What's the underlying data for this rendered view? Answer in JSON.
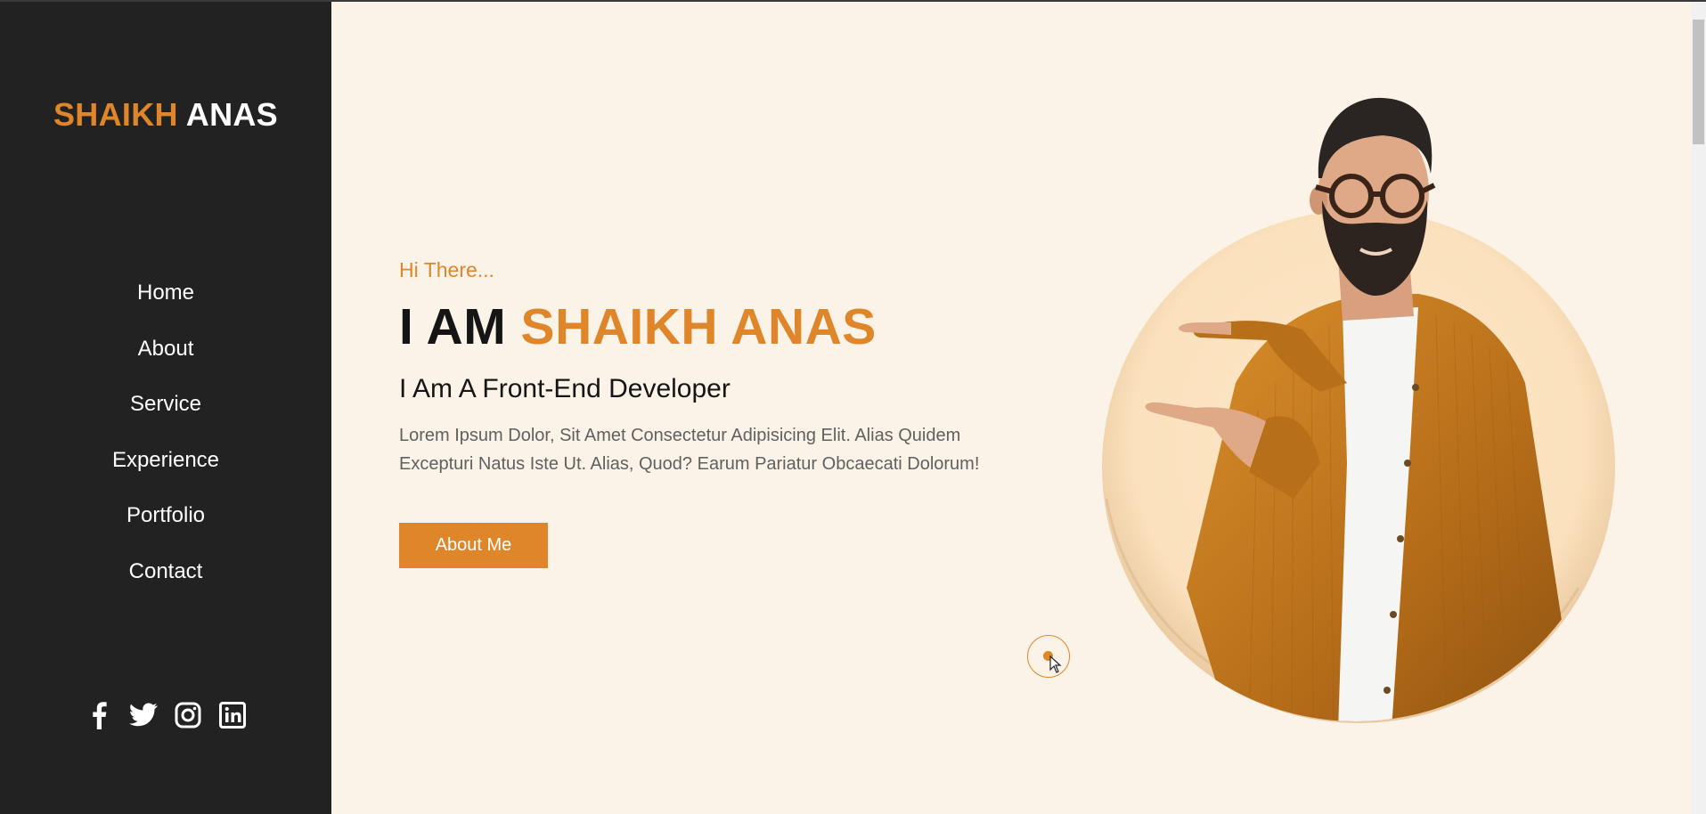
{
  "sidebar": {
    "logo": {
      "first": "SHAIKH",
      "last": "ANAS"
    },
    "nav": [
      "Home",
      "About",
      "Service",
      "Experience",
      "Portfolio",
      "Contact"
    ],
    "social": [
      "facebook-icon",
      "twitter-icon",
      "instagram-icon",
      "linkedin-icon"
    ]
  },
  "hero": {
    "greeting": "Hi There...",
    "headline_prefix": "I AM",
    "headline_name": "SHAIKH ANAS",
    "role": "I Am A Front-End Developer",
    "description": "Lorem Ipsum Dolor, Sit Amet Consectetur Adipisicing Elit. Alias Quidem Excepturi Natus Iste Ut. Alias, Quod? Earum Pariatur Obcaecati Dolorum!",
    "cta_label": "About Me"
  },
  "colors": {
    "accent": "#e0862a",
    "sidebar_bg": "#222222",
    "page_bg": "#fcf3e8",
    "text_dark": "#151515"
  }
}
